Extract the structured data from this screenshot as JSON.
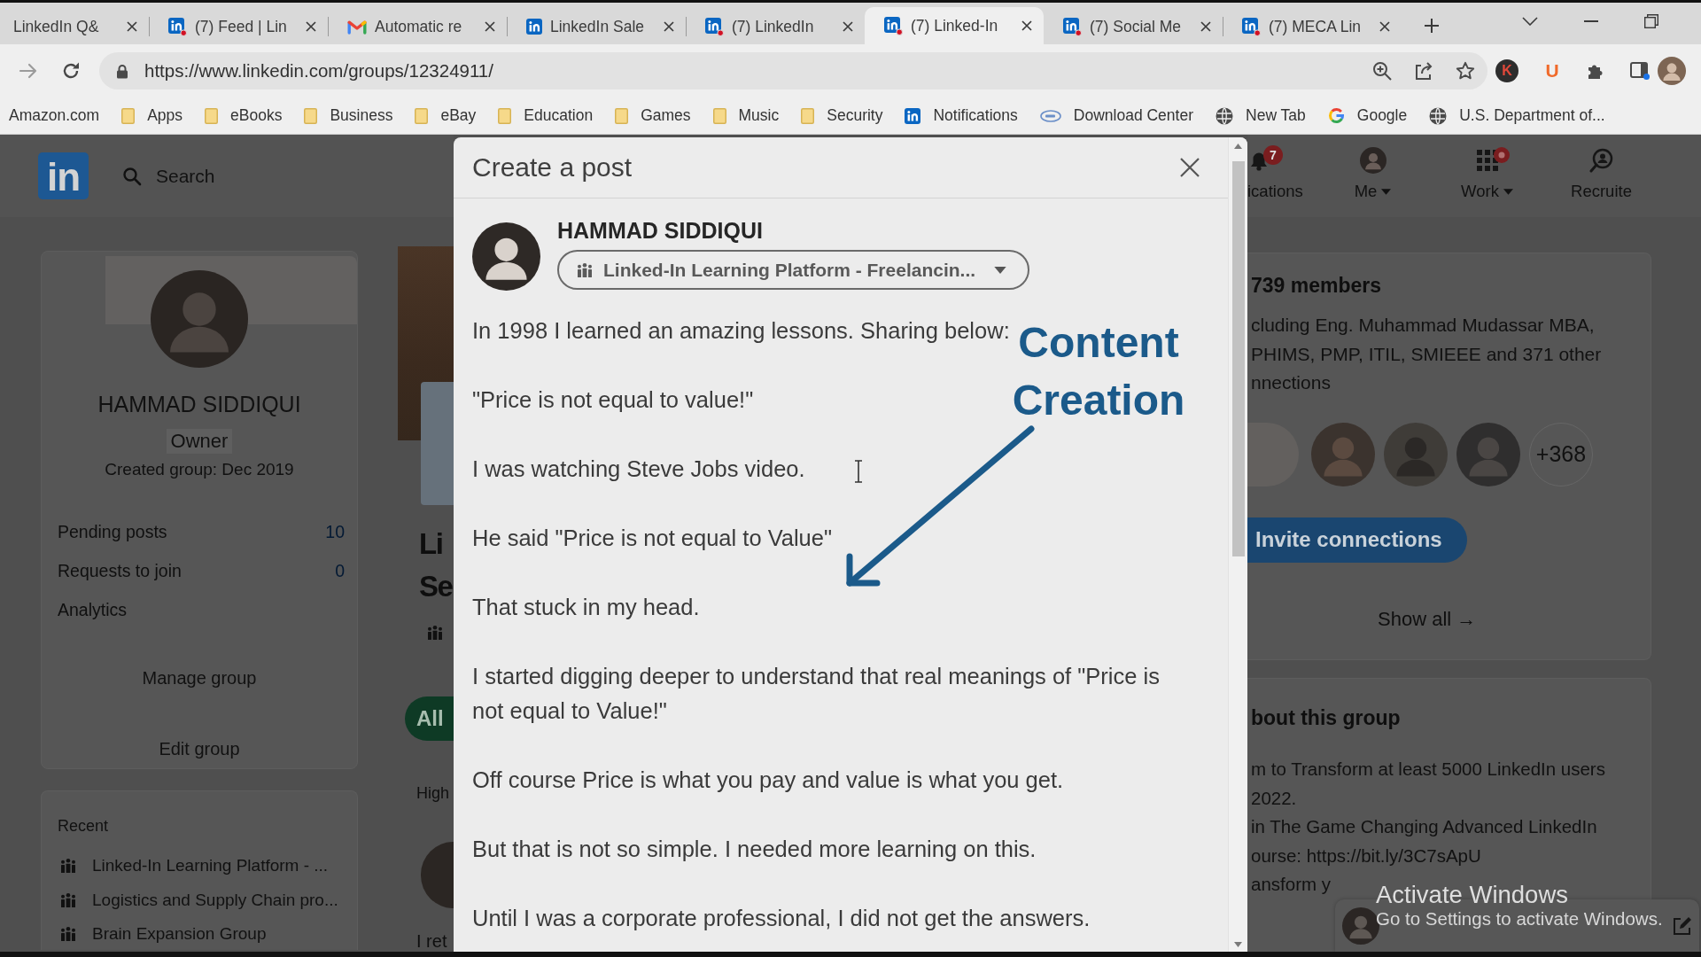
{
  "browser": {
    "tabs": [
      {
        "title": "LinkedIn Q&",
        "kind": "plain",
        "selected": false
      },
      {
        "title": "(7) Feed | Lin",
        "kind": "linkedin_badged",
        "selected": false
      },
      {
        "title": "Automatic re",
        "kind": "gmail",
        "selected": false
      },
      {
        "title": "LinkedIn Sale",
        "kind": "linkedin",
        "selected": false
      },
      {
        "title": "(7) LinkedIn",
        "kind": "linkedin_badged",
        "selected": false
      },
      {
        "title": "(7) Linked-In",
        "kind": "linkedin_badged",
        "selected": true
      },
      {
        "title": "(7) Social Me",
        "kind": "linkedin_badged",
        "selected": false
      },
      {
        "title": "(7) MECA Lin",
        "kind": "linkedin_badged",
        "selected": false
      }
    ],
    "address": "https://www.linkedin.com/groups/12324911/",
    "extensions": [
      {
        "glyph": "K",
        "kind": "disc"
      },
      {
        "glyph": "U",
        "kind": "plain"
      }
    ],
    "bookmarks": [
      {
        "label": "Amazon.com",
        "kind": "plain"
      },
      {
        "label": "Apps",
        "kind": "folder"
      },
      {
        "label": "eBooks",
        "kind": "folder"
      },
      {
        "label": "Business",
        "kind": "folder"
      },
      {
        "label": "eBay",
        "kind": "folder"
      },
      {
        "label": "Education",
        "kind": "folder"
      },
      {
        "label": "Games",
        "kind": "folder"
      },
      {
        "label": "Music",
        "kind": "folder"
      },
      {
        "label": "Security",
        "kind": "folder"
      },
      {
        "label": "Notifications",
        "kind": "linkedin"
      },
      {
        "label": "Download Center",
        "kind": "intel"
      },
      {
        "label": "New Tab",
        "kind": "globe"
      },
      {
        "label": "Google",
        "kind": "google"
      },
      {
        "label": "U.S. Department of...",
        "kind": "globe"
      }
    ]
  },
  "page": {
    "header": {
      "logo": "in",
      "search_placeholder": "Search",
      "nav": [
        {
          "label": "ications",
          "kind": "bell",
          "badge": "7",
          "caret": false,
          "dot": false
        },
        {
          "label": "Me",
          "kind": "avatar",
          "caret": true,
          "dot": false
        },
        {
          "label": "Work",
          "kind": "grid",
          "caret": true,
          "dot": true
        },
        {
          "label": "Recruite",
          "kind": "recruiter",
          "caret": false,
          "dot": false
        }
      ]
    },
    "profile_card": {
      "name": "HAMMAD SIDDIQUI",
      "role": "Owner",
      "created": "Created group: Dec 2019",
      "stats": [
        {
          "label": "Pending posts",
          "count": "10"
        },
        {
          "label": "Requests to join",
          "count": "0"
        },
        {
          "label": "Analytics"
        }
      ],
      "actions": [
        "Manage group",
        "Edit group"
      ]
    },
    "recent": {
      "title": "Recent",
      "items": [
        "Linked-In Learning Platform - ...",
        "Logistics and Supply Chain pro...",
        "Brain Expansion Group"
      ]
    },
    "group_column": {
      "title_lines": [
        "Li",
        "Se"
      ],
      "filter": "All",
      "section": "High",
      "post_excerpt": "I ret"
    },
    "members_card": {
      "count": "739 members",
      "description": [
        "cluding Eng. Muhammad Mudassar MBA,",
        "PHIMS, PMP, ITIL, SMIEEE and 371 other",
        "nnections"
      ],
      "more": "+368",
      "invite": "Invite connections",
      "show_all": "Show all →"
    },
    "about_card": {
      "title": "bout this group",
      "lines": [
        "m to Transform at least 5000 LinkedIn users",
        "2022.",
        "in The Game Changing Advanced LinkedIn",
        "ourse: https://bit.ly/3C7sApU",
        "ansform y"
      ]
    }
  },
  "modal": {
    "title": "Create a post",
    "author": "HAMMAD SIDDIQUI",
    "audience": "Linked-In Learning Platform - Freelancin...",
    "paragraphs": [
      "In 1998 I learned an amazing lessons. Sharing below:",
      "\"Price is not equal to value!\"",
      "I was watching Steve Jobs video.",
      "He said \"Price is not equal to Value\"",
      "That stuck in my head.",
      "I started digging deeper to understand that real meanings of \"Price is not equal to Value!\"",
      "Off course Price is what you pay and value is what you get.",
      "But that is not so simple. I needed more learning on this.",
      "Until I was a corporate professional, I did not get the answers."
    ]
  },
  "annotation": {
    "text": "Content Creation"
  },
  "os_notice": {
    "title": "Activate Windows",
    "subtitle": "Go to Settings to activate Windows."
  }
}
